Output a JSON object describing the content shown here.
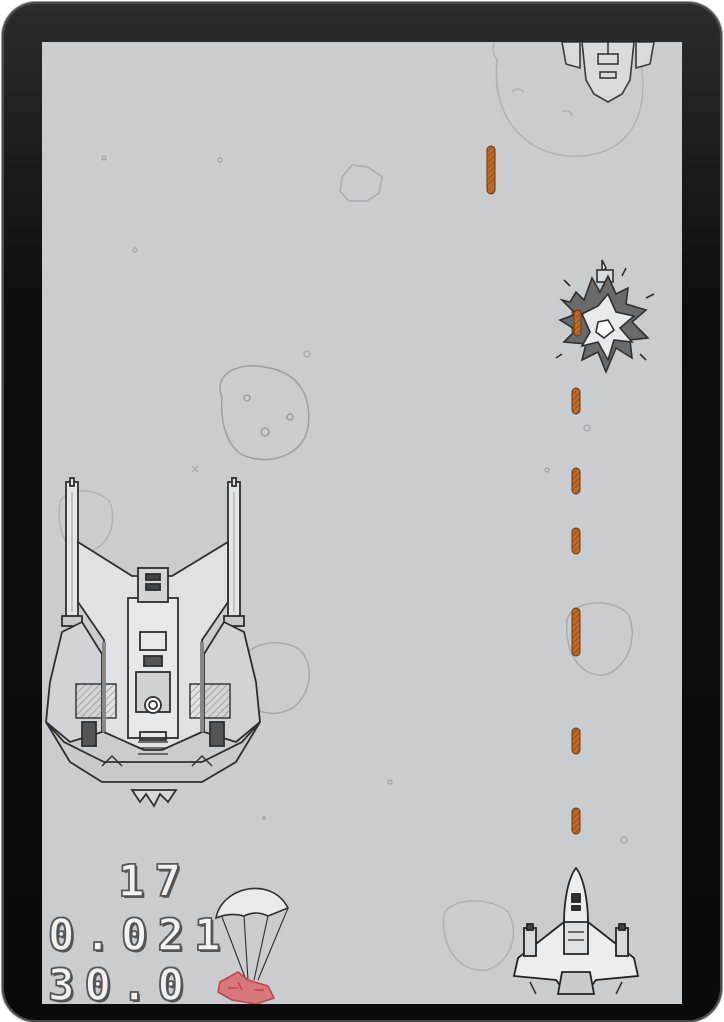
{
  "hud": {
    "score": "17",
    "timer": "0.021",
    "fps": "30.0"
  },
  "colors": {
    "background": "#c9cdd0",
    "ink": "#3a3a3a",
    "bullet": "#b5611f",
    "parachute_crate": "#c0444a",
    "hud_text": "#f2f2f2"
  },
  "icons": {
    "player": "player-fighter-jet-icon",
    "boss": "boss-battleship-icon",
    "enemy": "enemy-fighter-icon",
    "explosion": "explosion-icon",
    "powerup": "parachute-crate-icon",
    "asteroid": "asteroid-icon",
    "bullet": "bullet-icon"
  }
}
